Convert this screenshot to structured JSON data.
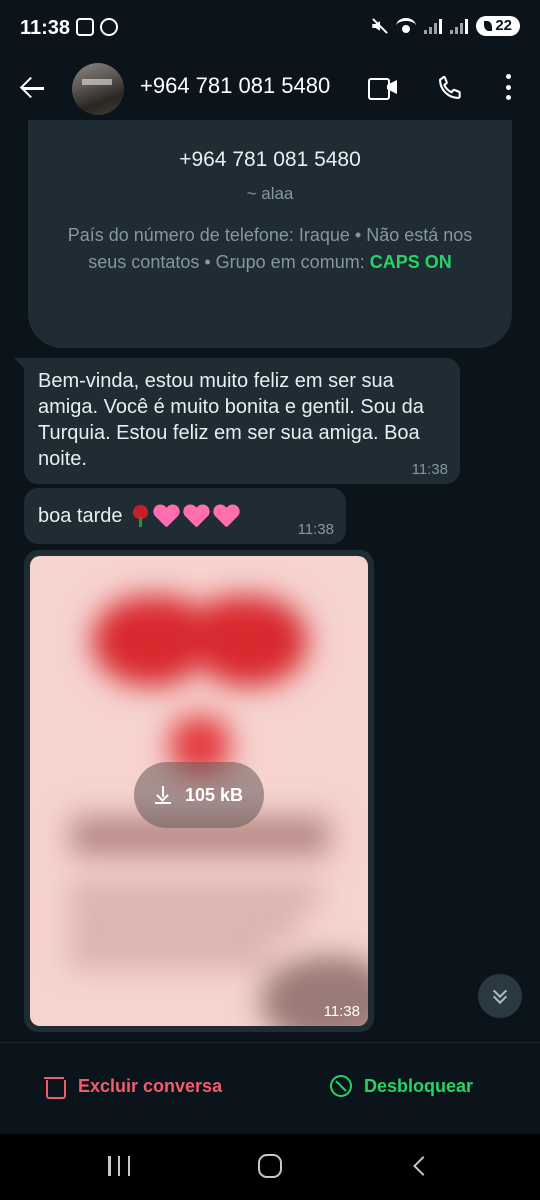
{
  "status_bar": {
    "time": "11:38",
    "battery": "22"
  },
  "header": {
    "title": "+964 781 081 5480"
  },
  "info_card": {
    "number": "+964 781 081 5480",
    "name": "~ alaa",
    "details_prefix": "País do número de telefone: Iraque • Não está nos seus contatos • Grupo em comum: ",
    "group_name": "CAPS ON"
  },
  "messages": [
    {
      "text": "Bem-vinda, estou muito feliz em ser sua amiga. Você é muito bonita e gentil. Sou da Turquia. Estou feliz em ser sua amiga. Boa noite.",
      "time": "11:38"
    },
    {
      "text": "boa tarde",
      "time": "11:38"
    },
    {
      "type": "image",
      "download_size": "105 kB",
      "time": "11:38"
    }
  ],
  "actions": {
    "delete_label": "Excluir conversa",
    "unblock_label": "Desbloquear"
  },
  "colors": {
    "accent_green": "#25d366",
    "danger_red": "#f15c6d",
    "bubble": "#1f2c33",
    "background": "#0b141a"
  },
  "icons": [
    "back-arrow-icon",
    "video-call-icon",
    "phone-icon",
    "more-options-icon",
    "download-icon",
    "scroll-down-icon",
    "trash-icon",
    "block-icon"
  ]
}
